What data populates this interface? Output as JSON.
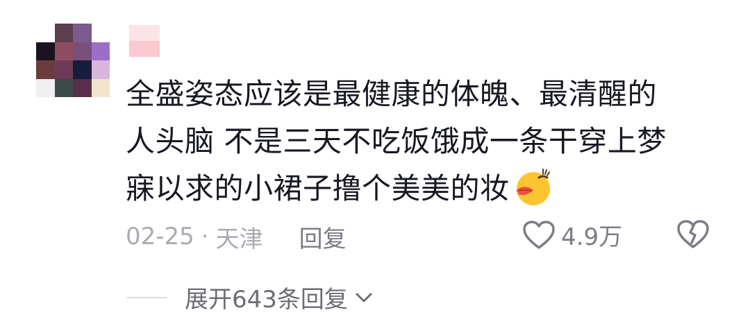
{
  "comment": {
    "avatar_icon": "pixelated-avatar-icon",
    "username_icon": "blurred-username-icon",
    "text_lines": [
      "全盛姿态应该是最健康的体魄、最清醒的",
      "人头脑 不是三天不吃饭饿成一条干穿上梦",
      "寐以求的小裙子撸个美美的妆"
    ],
    "emoji": "duck-lips-emoji",
    "date": "02-25",
    "separator": "·",
    "location": "天津",
    "reply_label": "回复",
    "like_count": "4.9万",
    "like_icon": "heart-outline-icon",
    "dislike_icon": "broken-heart-icon",
    "expand_label": "展开643条回复",
    "expand_icon": "chevron-down-icon"
  },
  "colors": {
    "text": "#161823",
    "meta": "#a9abb2",
    "action": "#7b7d85"
  }
}
